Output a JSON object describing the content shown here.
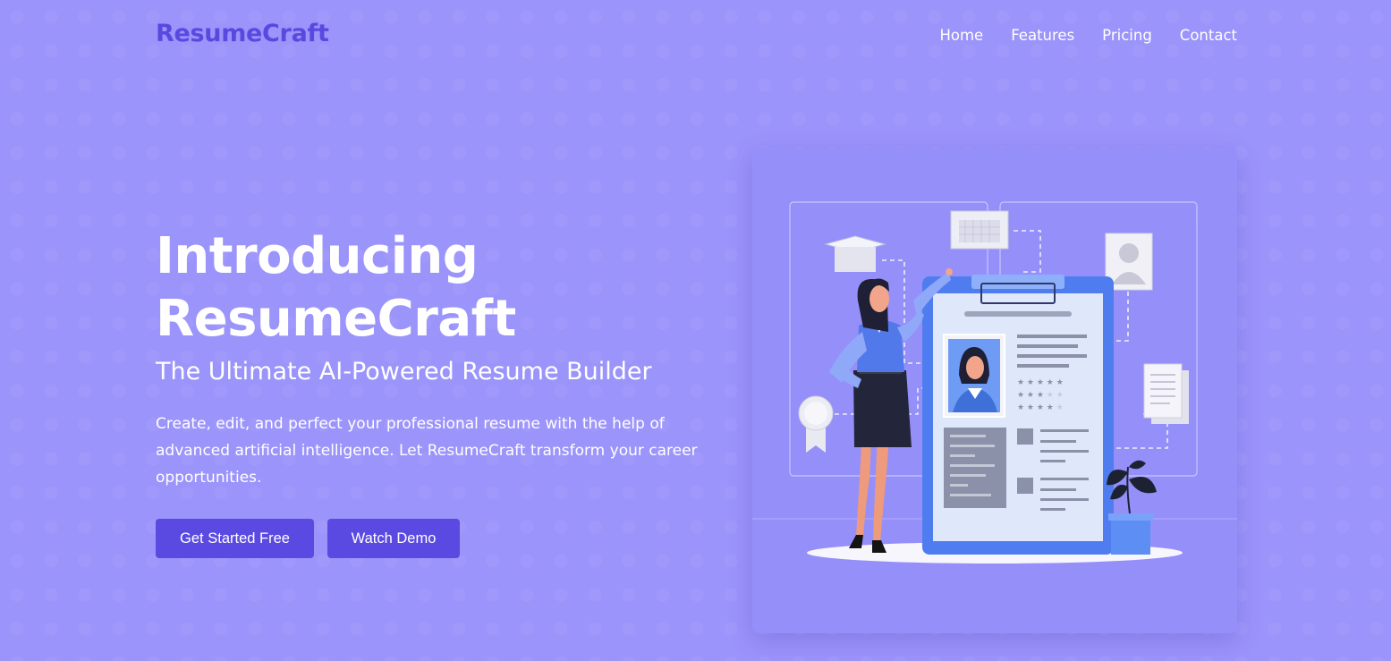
{
  "nav": {
    "logo": "ResumeCraft",
    "links": [
      "Home",
      "Features",
      "Pricing",
      "Contact"
    ]
  },
  "hero": {
    "title_line1": "Introducing",
    "title_line2": "ResumeCraft",
    "subtitle": "The Ultimate AI-Powered Resume Builder",
    "description": "Create, edit, and perfect your professional resume with the help of advanced artificial intelligence. Let ResumeCraft transform your career opportunities.",
    "primary_button": "Get Started Free",
    "secondary_button": "Watch Demo"
  },
  "colors": {
    "background": "#9b94fb",
    "brand": "#5a49df",
    "button": "#5b4ae1",
    "clipboard": "#4f7df0"
  },
  "illustration": {
    "icons": [
      "graduation-cap-icon",
      "calendar-icon",
      "profile-photo-icon",
      "document-icon",
      "award-badge-icon",
      "potted-plant-icon",
      "woman-figure"
    ]
  }
}
